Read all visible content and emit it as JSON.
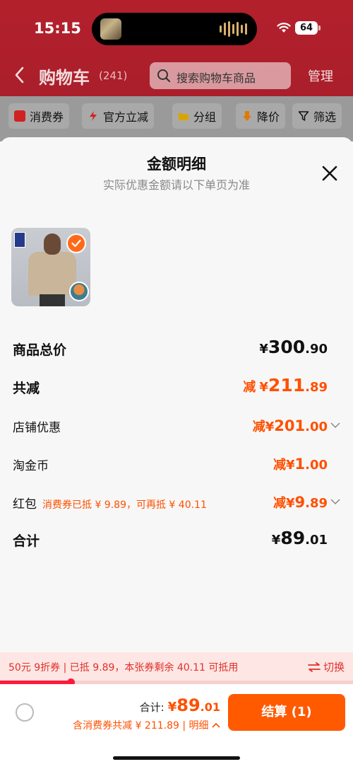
{
  "status_bar": {
    "time": "15:15",
    "battery": "64"
  },
  "nav": {
    "title": "购物车",
    "count": "(241)",
    "search_placeholder": "搜索购物车商品",
    "manage": "管理"
  },
  "filters": [
    {
      "label": "消费券",
      "icon": "coupon-icon"
    },
    {
      "label": "官方立减",
      "icon": "lightning-icon"
    },
    {
      "label": "分组",
      "icon": "folder-icon"
    },
    {
      "label": "降价",
      "icon": "down-arrow-icon"
    },
    {
      "label": "筛选",
      "icon": "filter-icon"
    }
  ],
  "sheet": {
    "title": "金额明细",
    "subtitle": "实际优惠金额请以下单页为准"
  },
  "breakdown": {
    "goods_total": {
      "label": "商品总价",
      "currency": "¥",
      "int": "300",
      "dec": ".90"
    },
    "total_discount": {
      "label": "共减",
      "prefix": "减",
      "currency": "¥",
      "int": "211",
      "dec": ".89"
    },
    "store_discount": {
      "label": "店铺优惠",
      "prefix": "减",
      "currency": "¥",
      "int": "201",
      "dec": ".00"
    },
    "taojinbi": {
      "label": "淘金币",
      "prefix": "减",
      "currency": "¥",
      "int": "1",
      "dec": ".00"
    },
    "red_packet": {
      "label": "红包",
      "note": "消费券已抵 ¥ 9.89，可再抵 ¥ 40.11",
      "prefix": "减",
      "currency": "¥",
      "int": "9",
      "dec": ".89"
    },
    "sum": {
      "label": "合计",
      "currency": "¥",
      "int": "89",
      "dec": ".01"
    }
  },
  "coupon_banner": {
    "text": "50元 9折券 | 已抵 9.89，本张券剩余 40.11 可抵用",
    "switch": "切换",
    "progress": 0.2
  },
  "checkout": {
    "total_label": "合计:",
    "currency": "¥",
    "total_int": "89",
    "total_dec": ".01",
    "sub_text": "含消费券共减 ¥ 211.89 | 明细",
    "button": "结算 (1)"
  },
  "colors": {
    "accent": "#ff5000",
    "button": "#ff5a00",
    "banner_text": "#e0302a"
  }
}
